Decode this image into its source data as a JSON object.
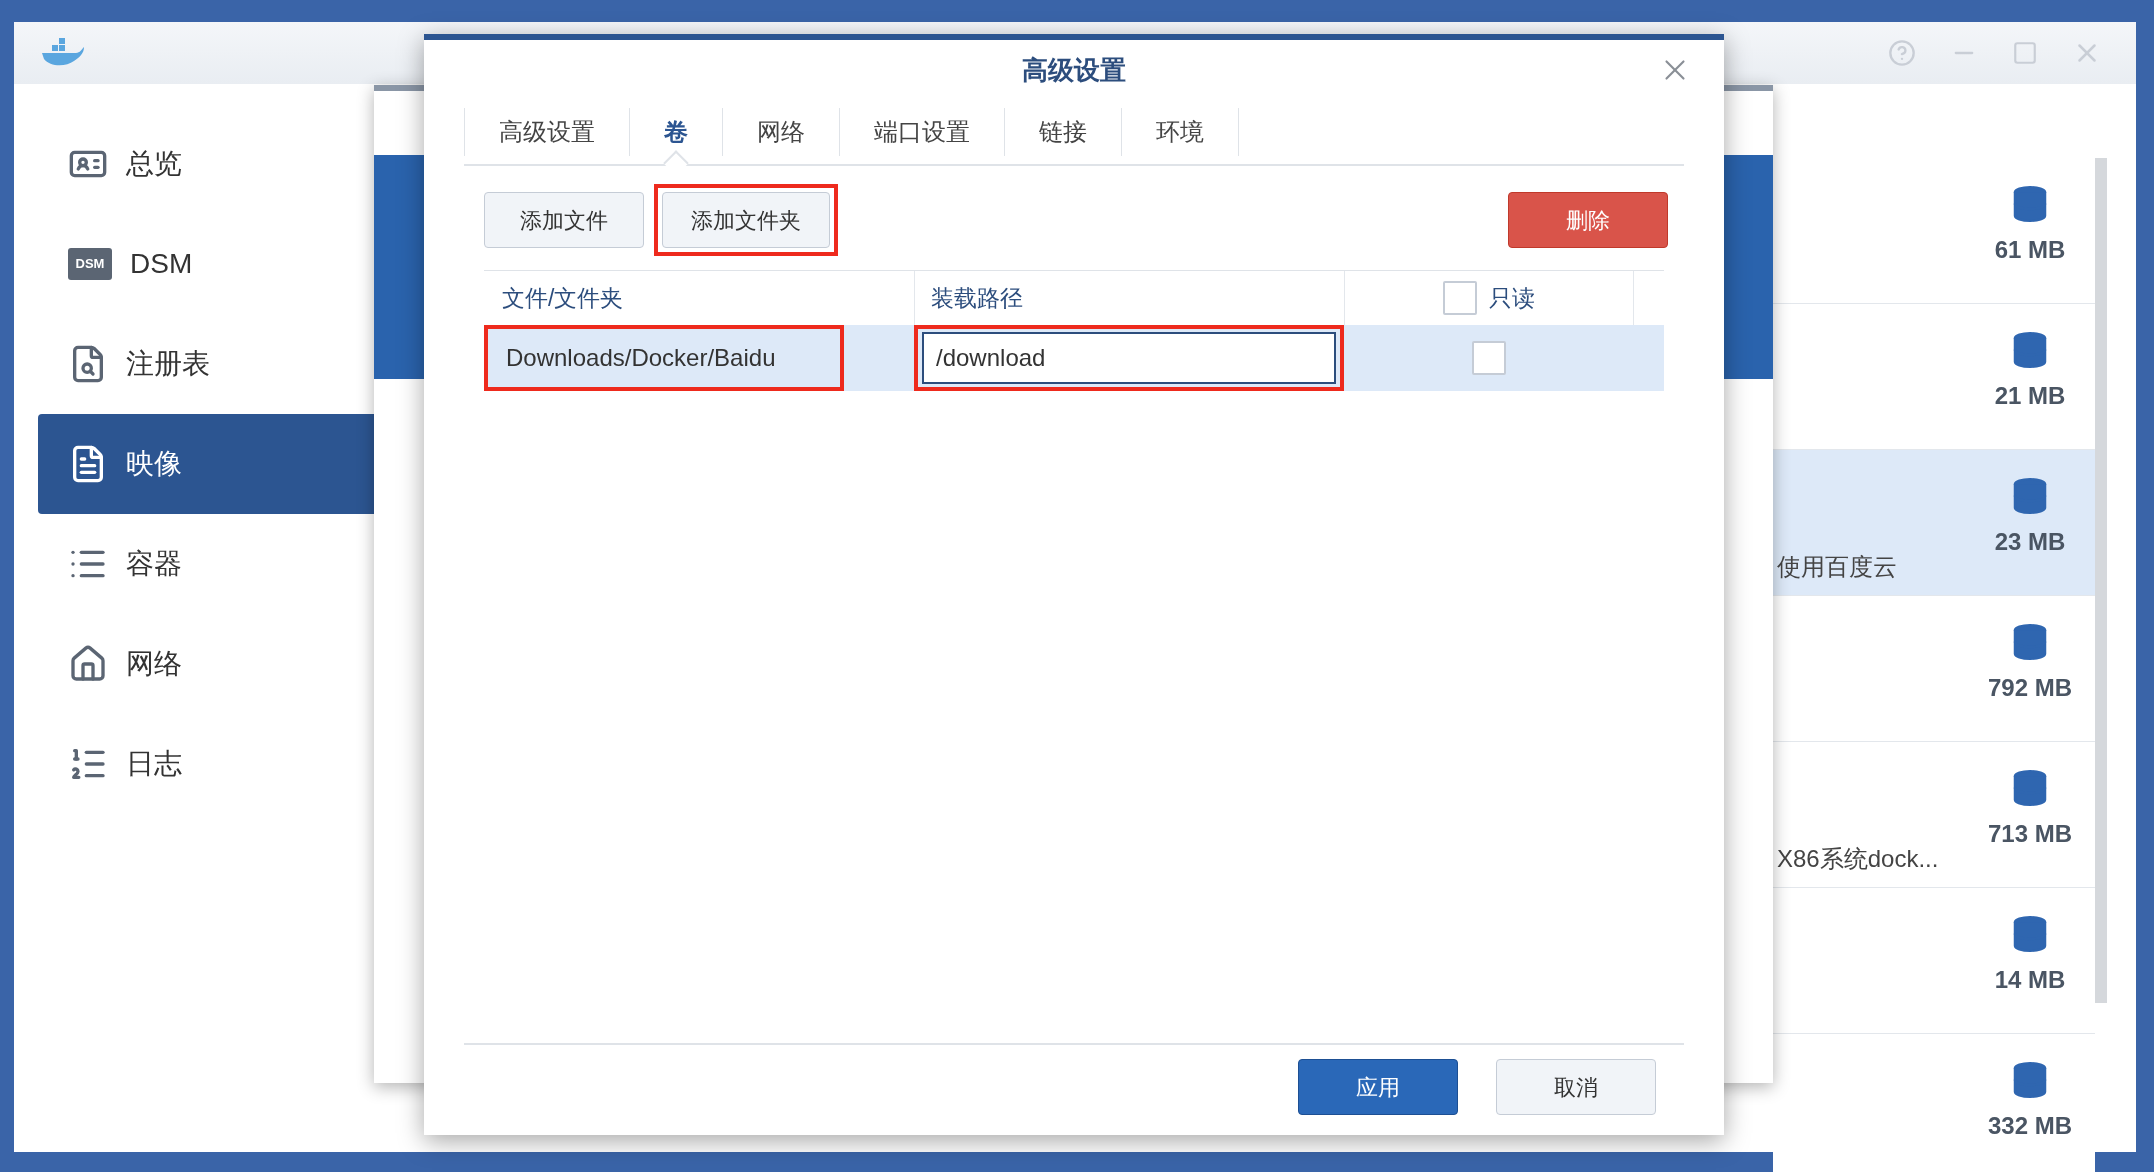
{
  "sidebar": {
    "items": [
      {
        "label": "总览",
        "selected": false
      },
      {
        "label": "DSM",
        "icon_text": "DSM",
        "selected": false
      },
      {
        "label": "注册表",
        "selected": false
      },
      {
        "label": "映像",
        "selected": true
      },
      {
        "label": "容器",
        "selected": false
      },
      {
        "label": "网络",
        "selected": false
      },
      {
        "label": "日志",
        "selected": false
      }
    ]
  },
  "image_list": [
    {
      "size": "61 MB",
      "selected": false
    },
    {
      "size": "21 MB",
      "selected": false
    },
    {
      "size": "23 MB",
      "description": "使用百度云",
      "selected": true
    },
    {
      "size": "792 MB",
      "selected": false
    },
    {
      "size": "713 MB",
      "description": "X86系统dock...",
      "selected": false
    },
    {
      "size": "14 MB",
      "selected": false
    },
    {
      "size": "332 MB",
      "selected": false
    }
  ],
  "dialog": {
    "title": "高级设置",
    "tabs": [
      {
        "label": "高级设置",
        "selected": false
      },
      {
        "label": "卷",
        "selected": true
      },
      {
        "label": "网络",
        "selected": false
      },
      {
        "label": "端口设置",
        "selected": false
      },
      {
        "label": "链接",
        "selected": false
      },
      {
        "label": "环境",
        "selected": false
      }
    ],
    "toolbar": [
      {
        "label": "添加文件",
        "kind": "plain",
        "highlighted": false
      },
      {
        "label": "添加文件夹",
        "kind": "plain",
        "highlighted": true
      },
      {
        "label": "删除",
        "kind": "danger",
        "highlighted": false
      }
    ],
    "table": {
      "columns": [
        {
          "label": "文件/文件夹"
        },
        {
          "label": "装载路径"
        },
        {
          "label": "只读",
          "checked": false
        }
      ],
      "rows": [
        {
          "file": "Downloads/Docker/Baidu",
          "file_highlighted": true,
          "path": "/download",
          "path_highlighted": true,
          "readonly": false,
          "selected": true
        }
      ]
    },
    "buttons": [
      {
        "label": "应用",
        "kind": "primary"
      },
      {
        "label": "取消",
        "kind": "plain"
      }
    ]
  }
}
